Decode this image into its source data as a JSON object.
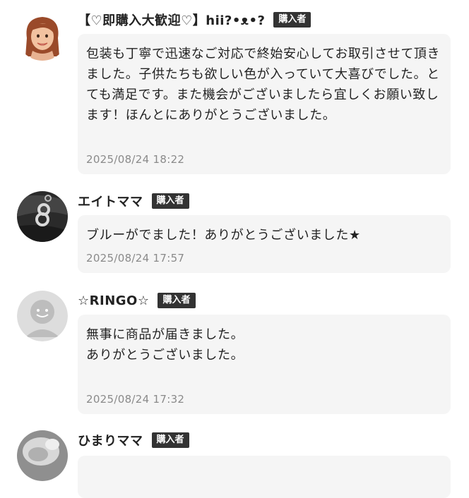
{
  "reviews": [
    {
      "name": "【♡即購入大歓迎♡】hii?•ᴥ•?",
      "badge": "購入者",
      "comment": "包装も丁寧で迅速なご対応で終始安心してお取引させて頂きました。子供たちも欲しい色が入っていて大喜びでした。とても満足です。また機会がございましたら宜しくお願い致します！ほんとにありがとうございました。",
      "date": "2025/08/24 18:22",
      "avatar": "memoji-woman-avatar"
    },
    {
      "name": "エイトママ",
      "badge": "購入者",
      "comment": "ブルーがでました！ありがとうございました★",
      "date": "2025/08/24 17:57",
      "avatar": "number-eight-charm-avatar"
    },
    {
      "name": "☆RINGO☆",
      "badge": "購入者",
      "comment": "無事に商品が届きました。\nありがとうございました。",
      "date": "2025/08/24 17:32",
      "avatar": "default-user-avatar"
    },
    {
      "name": "ひまりママ",
      "badge": "購入者",
      "comment": "",
      "date": "",
      "avatar": "pet-photo-avatar"
    }
  ]
}
